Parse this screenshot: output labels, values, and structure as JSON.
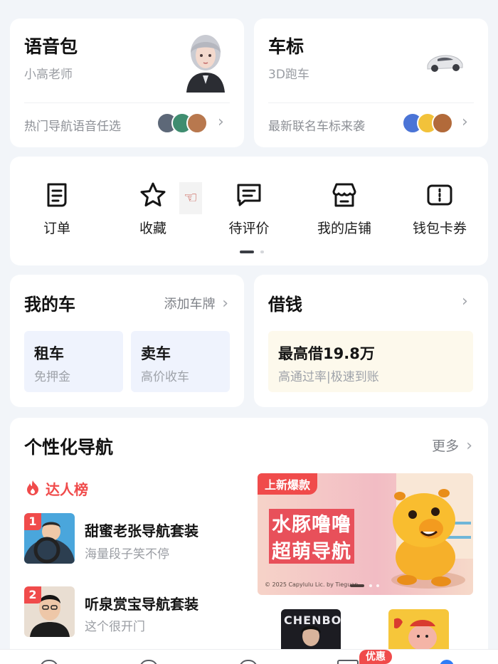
{
  "voice_pack": {
    "title": "语音包",
    "subtitle": "小高老师",
    "footer": "热门导航语音任选"
  },
  "car_badge": {
    "title": "车标",
    "subtitle": "3D跑车",
    "footer": "最新联名车标来袭"
  },
  "quick_actions": [
    {
      "label": "订单",
      "icon": "order-icon"
    },
    {
      "label": "收藏",
      "icon": "star-icon"
    },
    {
      "label": "待评价",
      "icon": "review-icon"
    },
    {
      "label": "我的店铺",
      "icon": "store-icon"
    },
    {
      "label": "钱包卡券",
      "icon": "wallet-coupon-icon"
    }
  ],
  "my_car": {
    "title": "我的车",
    "add_plate": "添加车牌",
    "tiles": [
      {
        "title": "租车",
        "sub": "免押金"
      },
      {
        "title": "卖车",
        "sub": "高价收车"
      }
    ]
  },
  "loan": {
    "title": "借钱",
    "headline": "最高借19.8万",
    "sub": "高通过率|极速到账"
  },
  "personal_nav": {
    "title": "个性化导航",
    "more": "更多",
    "ranking_label": "达人榜",
    "items": [
      {
        "rank": "1",
        "name": "甜蜜老张导航套装",
        "desc": "海量段子笑不停"
      },
      {
        "rank": "2",
        "name": "听泉赏宝导航套装",
        "desc": "这个很开门"
      }
    ],
    "banner": {
      "tag": "上新爆款",
      "line1": "水豚噜噜",
      "line2": "超萌导航",
      "copyright": "© 2025 Capylulu Lic. by Tieguan"
    },
    "small_cards": [
      {
        "text": "CHENBO"
      },
      {
        "text": ""
      }
    ]
  },
  "bottom_nav": {
    "promo_badge": "优惠"
  },
  "colors": {
    "accent_red": "#f04b4b",
    "tile_blue": "#eff3fd",
    "tile_cream": "#fdf9ec",
    "page_bg": "#f2f5f9"
  }
}
